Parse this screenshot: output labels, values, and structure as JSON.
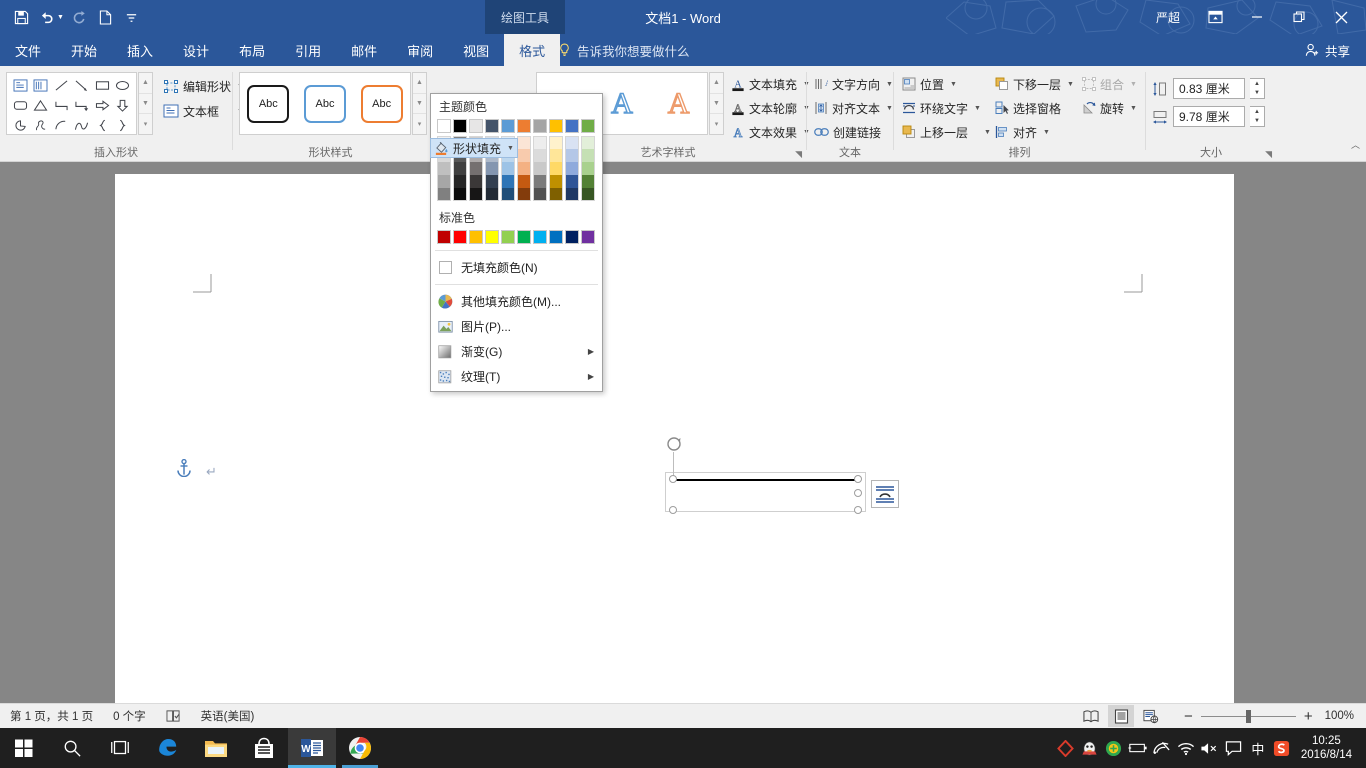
{
  "titlebar": {
    "qat": [
      {
        "name": "save-icon",
        "label": "保存"
      },
      {
        "name": "undo-icon",
        "label": "撤消"
      },
      {
        "name": "redo-icon",
        "label": "恢复"
      },
      {
        "name": "new-doc-icon",
        "label": "新建"
      },
      {
        "name": "customize-qat-icon",
        "label": "自定义快速访问工具栏"
      }
    ],
    "context_tab": "绘图工具",
    "title": "文档1 - Word",
    "user": "严超",
    "ribbon_display_options": "功能区显示选项",
    "minimize": "最小化",
    "restore": "向下还原",
    "close": "关闭"
  },
  "tabs": [
    {
      "label": "文件",
      "active": false,
      "file": true
    },
    {
      "label": "开始",
      "active": false
    },
    {
      "label": "插入",
      "active": false
    },
    {
      "label": "设计",
      "active": false
    },
    {
      "label": "布局",
      "active": false
    },
    {
      "label": "引用",
      "active": false
    },
    {
      "label": "邮件",
      "active": false
    },
    {
      "label": "审阅",
      "active": false
    },
    {
      "label": "视图",
      "active": false
    },
    {
      "label": "格式",
      "active": true
    }
  ],
  "tellme": "告诉我你想要做什么",
  "share": "共享",
  "ribbon": {
    "groups": [
      {
        "label": "插入形状"
      },
      {
        "label": "形状样式"
      },
      {
        "label": "艺术字样式"
      },
      {
        "label": "文本"
      },
      {
        "label": "排列"
      },
      {
        "label": "大小"
      }
    ],
    "insert_shapes": {
      "edit_shape": "编辑形状",
      "text_box": "文本框",
      "shape_icons": [
        "textbox-shape-icon",
        "vertical-textbox-shape-icon",
        "line-shape-icon",
        "arrow-line-shape-icon",
        "rectangle-shape-icon",
        "oval-shape-icon",
        "rounded-rectangle-shape-icon",
        "triangle-shape-icon",
        "elbow-connector-shape-icon",
        "elbow-arrow-connector-shape-icon",
        "right-arrow-shape-icon",
        "down-arrow-shape-icon",
        "pie-shape-icon",
        "scribble-shape-icon",
        "arc-shape-icon",
        "curve-shape-icon",
        "left-brace-shape-icon",
        "right-brace-shape-icon"
      ]
    },
    "shape_styles": [
      {
        "name": "shape-style-black",
        "text": "Abc",
        "border": "#1a1a1a"
      },
      {
        "name": "shape-style-blue",
        "text": "Abc",
        "border": "#5b9bd5"
      },
      {
        "name": "shape-style-orange",
        "text": "Abc",
        "border": "#ed7d31"
      }
    ],
    "shape_fill": "形状填充",
    "wordart_styles": [
      {
        "name": "wordart-style-black",
        "letter": "A",
        "color": "#1a1a1a"
      },
      {
        "name": "wordart-style-blue",
        "letter": "A",
        "color": "#5b9bd5"
      },
      {
        "name": "wordart-style-orange",
        "letter": "A",
        "color": "#ed9a6a"
      }
    ],
    "wordart_buttons": [
      {
        "label": "文本填充",
        "icon": "text-fill-icon"
      },
      {
        "label": "文本轮廓",
        "icon": "text-outline-icon"
      },
      {
        "label": "文本效果",
        "icon": "text-effects-icon"
      }
    ],
    "text_group": [
      {
        "label": "文字方向",
        "icon": "text-direction-icon"
      },
      {
        "label": "对齐文本",
        "icon": "align-text-icon"
      },
      {
        "label": "创建链接",
        "icon": "create-link-icon"
      }
    ],
    "arrange_group": [
      {
        "label": "位置",
        "icon": "position-icon"
      },
      {
        "label": "环绕文字",
        "icon": "wrap-text-icon"
      },
      {
        "label": "上移一层",
        "icon": "bring-forward-icon"
      },
      {
        "label": "下移一层",
        "icon": "send-backward-icon"
      },
      {
        "label": "选择窗格",
        "icon": "selection-pane-icon"
      },
      {
        "label": "对齐",
        "icon": "align-objects-icon"
      },
      {
        "label": "组合",
        "icon": "group-icon",
        "disabled": true
      },
      {
        "label": "旋转",
        "icon": "rotate-icon"
      }
    ],
    "size_group": {
      "height_label": "形状高度",
      "height_value": "0.83 厘米",
      "width_label": "形状宽度",
      "width_value": "9.78 厘米"
    },
    "collapse_ribbon": "折叠功能区"
  },
  "fill_menu": {
    "theme_colors_header": "主题颜色",
    "theme_colors": [
      "#ffffff",
      "#000000",
      "#e7e6e6",
      "#44546a",
      "#5b9bd5",
      "#ed7d31",
      "#a5a5a5",
      "#ffc000",
      "#4472c4",
      "#70ad47"
    ],
    "theme_variants": [
      [
        "#f2f2f2",
        "#808080",
        "#d0cece",
        "#d6dce5",
        "#deebf7",
        "#fbe5d6",
        "#ededed",
        "#fff2cc",
        "#d9e2f3",
        "#e2efd9"
      ],
      [
        "#d9d9d9",
        "#595959",
        "#aeaaaa",
        "#adb9ca",
        "#bdd7ee",
        "#f8cbad",
        "#dbdbdb",
        "#ffe699",
        "#b4c7e7",
        "#c5e0b4"
      ],
      [
        "#bfbfbf",
        "#404040",
        "#757070",
        "#8496b0",
        "#9dc3e6",
        "#f4b183",
        "#c9c9c9",
        "#ffd966",
        "#8faadc",
        "#a9d18e"
      ],
      [
        "#a6a6a6",
        "#262626",
        "#3b3838",
        "#333f50",
        "#2e75b6",
        "#c55a11",
        "#7b7b7b",
        "#bf9000",
        "#2f5597",
        "#538135"
      ],
      [
        "#808080",
        "#0d0d0d",
        "#171616",
        "#222a35",
        "#1f4e79",
        "#833c0c",
        "#525252",
        "#7f6000",
        "#1f3864",
        "#375623"
      ]
    ],
    "standard_colors_header": "标准色",
    "standard_colors": [
      "#c00000",
      "#ff0000",
      "#ffc000",
      "#ffff00",
      "#92d050",
      "#00b050",
      "#00b0f0",
      "#0070c0",
      "#002060",
      "#7030a0"
    ],
    "items": [
      {
        "label": "无填充颜色(N)",
        "icon": "no-fill-icon"
      },
      {
        "label": "其他填充颜色(M)...",
        "icon": "more-fill-colors-icon"
      },
      {
        "label": "图片(P)...",
        "icon": "picture-fill-icon"
      },
      {
        "label": "渐变(G)",
        "icon": "gradient-fill-icon",
        "submenu": true
      },
      {
        "label": "纹理(T)",
        "icon": "texture-fill-icon",
        "submenu": true
      }
    ]
  },
  "document": {
    "anchor_icon": "object-anchor-icon",
    "paragraph_mark": "↵",
    "selected_shape": "straight-line-shape",
    "layout_options_icon": "layout-options-icon"
  },
  "statusbar": {
    "page_info": "第 1 页，共 1 页",
    "word_count": "0 个字",
    "proofing_icon": "proofing-errors-icon",
    "language": "英语(美国)",
    "views": [
      {
        "name": "read-mode-view-button",
        "active": false
      },
      {
        "name": "print-layout-view-button",
        "active": true
      },
      {
        "name": "web-layout-view-button",
        "active": false
      }
    ],
    "zoom_out": "−",
    "zoom_in": "+",
    "zoom_level": "100%"
  },
  "taskbar": {
    "items": [
      {
        "name": "start-button",
        "icon": "windows-logo-icon"
      },
      {
        "name": "search-button",
        "icon": "search-icon"
      },
      {
        "name": "task-view-button",
        "icon": "task-view-icon"
      },
      {
        "name": "edge-button",
        "icon": "edge-icon"
      },
      {
        "name": "file-explorer-button",
        "icon": "folder-icon"
      },
      {
        "name": "store-button",
        "icon": "store-icon"
      },
      {
        "name": "word-button",
        "icon": "word-icon",
        "active": true
      },
      {
        "name": "chrome-button",
        "icon": "chrome-icon",
        "running": true
      }
    ],
    "tray": [
      {
        "name": "tray-icon-youdao"
      },
      {
        "name": "tray-icon-qq"
      },
      {
        "name": "tray-icon-360"
      },
      {
        "name": "tray-icon-battery"
      },
      {
        "name": "tray-icon-network-error"
      },
      {
        "name": "tray-icon-wifi"
      },
      {
        "name": "tray-icon-volume-muted"
      },
      {
        "name": "tray-icon-action-center"
      },
      {
        "name": "tray-icon-ime",
        "label": "中"
      },
      {
        "name": "tray-icon-sogou"
      }
    ],
    "clock_time": "10:25",
    "clock_date": "2016/8/14"
  }
}
